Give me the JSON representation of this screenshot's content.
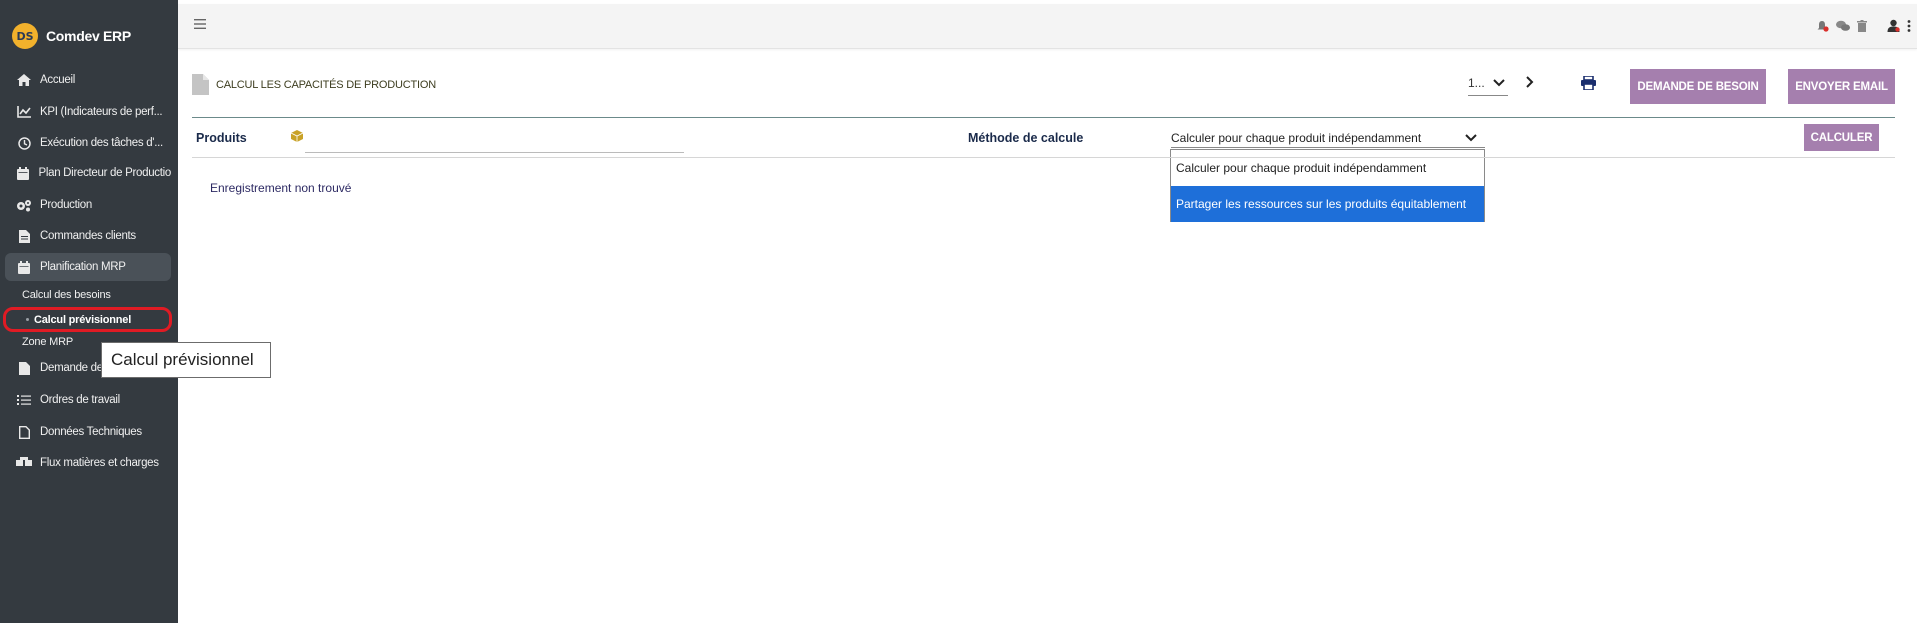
{
  "sidebar": {
    "brand": {
      "logo_text": "DS",
      "name": "Comdev ERP"
    },
    "items": [
      {
        "label": "Accueil",
        "icon": "home-icon"
      },
      {
        "label": "KPI (Indicateurs de perf...",
        "icon": "chart-line-icon"
      },
      {
        "label": "Exécution des tâches d'...",
        "icon": "clock-icon"
      },
      {
        "label": "Plan Directeur de Productio",
        "icon": "calendar-icon"
      },
      {
        "label": "Production",
        "icon": "gears-icon"
      },
      {
        "label": "Commandes clients",
        "icon": "document-icon"
      },
      {
        "label": "Planification MRP",
        "icon": "calendar-icon"
      },
      {
        "label": "Demande de",
        "icon": "document-icon"
      },
      {
        "label": "Ordres de travail",
        "icon": "list-check-icon"
      },
      {
        "label": "Données Techniques",
        "icon": "file-outline-icon"
      },
      {
        "label": "Flux matières et charges",
        "icon": "boxes-icon"
      }
    ],
    "submenu": {
      "calcul_besoins": "Calcul des besoins",
      "calcul_previsionnel": "Calcul prévisionnel",
      "zone_mrp": "Zone MRP"
    },
    "tooltip": "Calcul prévisionnel"
  },
  "toolbar": {
    "page_title": "CALCUL LES CAPACITÉS DE PRODUCTION",
    "pager_value": "1...",
    "demande_button": "DEMANDE DE BESOIN",
    "email_button": "ENVOYER EMAIL"
  },
  "form": {
    "produits_label": "Produits",
    "produits_value": "",
    "methode_label": "Méthode de calcule",
    "methode_selected": "Calculer pour chaque produit indépendamment",
    "methode_options": [
      "Calculer pour chaque produit indépendamment",
      "Partager les ressources sur les produits équitablement"
    ],
    "calculer_button": "CALCULER"
  },
  "results": {
    "empty_message": "Enregistrement non trouvé"
  },
  "colors": {
    "sidebar_bg": "#343a40",
    "accent_button": "#a57fae",
    "selected_option": "#1e6fd9",
    "highlight_ring": "#e01b24"
  }
}
